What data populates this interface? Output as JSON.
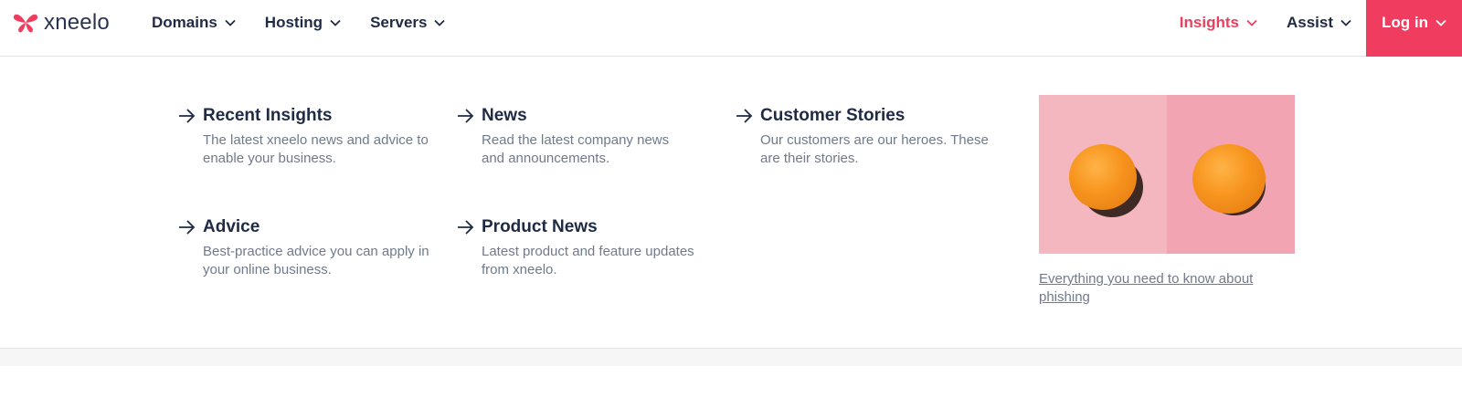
{
  "brand": {
    "name": "xneelo"
  },
  "nav": {
    "left": [
      {
        "label": "Domains"
      },
      {
        "label": "Hosting"
      },
      {
        "label": "Servers"
      }
    ],
    "right": [
      {
        "label": "Insights"
      },
      {
        "label": "Assist"
      }
    ],
    "login_label": "Log in"
  },
  "menu": {
    "links": [
      {
        "title": "Recent Insights",
        "desc": "The latest xneelo news and advice to enable your business."
      },
      {
        "title": "News",
        "desc": "Read the latest company news and announcements."
      },
      {
        "title": "Customer Stories",
        "desc": "Our customers are our heroes. These are their stories."
      },
      {
        "title": "Advice",
        "desc": "Best-practice advice you can apply in your online business."
      },
      {
        "title": "Product News",
        "desc": "Latest product and feature updates from xneelo."
      }
    ],
    "feature": {
      "link_text": "Everything you need to know about phishing"
    }
  },
  "colors": {
    "accent": "#f03d5f",
    "active_nav": "#e8415f",
    "text_dark": "#1f2a44",
    "text_muted": "#707a8c"
  },
  "icons": {
    "logo": "butterfly-logo-icon",
    "dropdown": "chevron-down-icon",
    "link": "arrow-right-icon"
  }
}
